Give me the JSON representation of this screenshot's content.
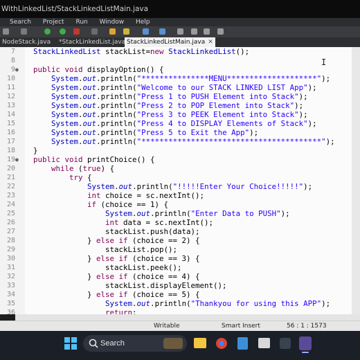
{
  "window": {
    "title": "WithLinkedList/StackLinkedListMain.java"
  },
  "menu": [
    "Search",
    "Project",
    "Run",
    "Window",
    "Help"
  ],
  "tabs": [
    {
      "label": "NodeStack.java",
      "active": false
    },
    {
      "label": "*StackLinkedList.java",
      "active": false
    },
    {
      "label": "StackLinkedListMain.java",
      "active": true
    }
  ],
  "editor": {
    "lines": [
      {
        "n": "7",
        "segs": [
          {
            "c": "ty",
            "t": "StackLinkedList"
          },
          {
            "c": "",
            "t": " stackList="
          },
          {
            "c": "kw",
            "t": "new"
          },
          {
            "c": "",
            "t": " "
          },
          {
            "c": "ty",
            "t": "StackLinkedList"
          },
          {
            "c": "",
            "t": "();"
          }
        ]
      },
      {
        "n": "8",
        "segs": []
      },
      {
        "n": "9",
        "fold": true,
        "segs": [
          {
            "c": "kw",
            "t": "public"
          },
          {
            "c": "",
            "t": " "
          },
          {
            "c": "kw",
            "t": "void"
          },
          {
            "c": "",
            "t": " displayOption() {"
          }
        ]
      },
      {
        "n": "10",
        "segs": [
          {
            "c": "",
            "t": "    "
          },
          {
            "c": "ty",
            "t": "System"
          },
          {
            "c": "",
            "t": "."
          },
          {
            "c": "fi",
            "t": "out"
          },
          {
            "c": "",
            "t": ".println("
          },
          {
            "c": "st",
            "t": "\"***************MENU********************\""
          },
          {
            "c": "",
            "t": ");"
          }
        ]
      },
      {
        "n": "11",
        "segs": [
          {
            "c": "",
            "t": "    "
          },
          {
            "c": "ty",
            "t": "System"
          },
          {
            "c": "",
            "t": "."
          },
          {
            "c": "fi",
            "t": "out"
          },
          {
            "c": "",
            "t": ".println("
          },
          {
            "c": "st",
            "t": "\"Welcome to our STACK LINKED LIST App\""
          },
          {
            "c": "",
            "t": ");"
          }
        ]
      },
      {
        "n": "12",
        "segs": [
          {
            "c": "",
            "t": "    "
          },
          {
            "c": "ty",
            "t": "System"
          },
          {
            "c": "",
            "t": "."
          },
          {
            "c": "fi",
            "t": "out"
          },
          {
            "c": "",
            "t": ".println("
          },
          {
            "c": "st",
            "t": "\"Press 1 to PUSH Element into Stack\""
          },
          {
            "c": "",
            "t": ");"
          }
        ]
      },
      {
        "n": "13",
        "segs": [
          {
            "c": "",
            "t": "    "
          },
          {
            "c": "ty",
            "t": "System"
          },
          {
            "c": "",
            "t": "."
          },
          {
            "c": "fi",
            "t": "out"
          },
          {
            "c": "",
            "t": ".println("
          },
          {
            "c": "st",
            "t": "\"Press 2 to POP Element into Stack\""
          },
          {
            "c": "",
            "t": ");"
          }
        ]
      },
      {
        "n": "14",
        "segs": [
          {
            "c": "",
            "t": "    "
          },
          {
            "c": "ty",
            "t": "System"
          },
          {
            "c": "",
            "t": "."
          },
          {
            "c": "fi",
            "t": "out"
          },
          {
            "c": "",
            "t": ".println("
          },
          {
            "c": "st",
            "t": "\"Press 3 to PEEK Element into Stack\""
          },
          {
            "c": "",
            "t": ");"
          }
        ]
      },
      {
        "n": "15",
        "segs": [
          {
            "c": "",
            "t": "    "
          },
          {
            "c": "ty",
            "t": "System"
          },
          {
            "c": "",
            "t": "."
          },
          {
            "c": "fi",
            "t": "out"
          },
          {
            "c": "",
            "t": ".println("
          },
          {
            "c": "st",
            "t": "\"Press 4 to DISPLAY Elements of Stack\""
          },
          {
            "c": "",
            "t": ");"
          }
        ]
      },
      {
        "n": "16",
        "segs": [
          {
            "c": "",
            "t": "    "
          },
          {
            "c": "ty",
            "t": "System"
          },
          {
            "c": "",
            "t": "."
          },
          {
            "c": "fi",
            "t": "out"
          },
          {
            "c": "",
            "t": ".println("
          },
          {
            "c": "st",
            "t": "\"Press 5 to Exit the App\""
          },
          {
            "c": "",
            "t": ");"
          }
        ]
      },
      {
        "n": "17",
        "segs": [
          {
            "c": "",
            "t": "    "
          },
          {
            "c": "ty",
            "t": "System"
          },
          {
            "c": "",
            "t": "."
          },
          {
            "c": "fi",
            "t": "out"
          },
          {
            "c": "",
            "t": ".println("
          },
          {
            "c": "st",
            "t": "\"****************************************\""
          },
          {
            "c": "",
            "t": ");"
          }
        ]
      },
      {
        "n": "18",
        "segs": [
          {
            "c": "",
            "t": "}"
          }
        ]
      },
      {
        "n": "19",
        "fold": true,
        "segs": [
          {
            "c": "kw",
            "t": "public"
          },
          {
            "c": "",
            "t": " "
          },
          {
            "c": "kw",
            "t": "void"
          },
          {
            "c": "",
            "t": " printChoice() {"
          }
        ]
      },
      {
        "n": "20",
        "segs": [
          {
            "c": "",
            "t": "    "
          },
          {
            "c": "kw",
            "t": "while"
          },
          {
            "c": "",
            "t": " ("
          },
          {
            "c": "kw",
            "t": "true"
          },
          {
            "c": "",
            "t": ") {"
          }
        ]
      },
      {
        "n": "21",
        "segs": [
          {
            "c": "",
            "t": "        "
          },
          {
            "c": "kw",
            "t": "try"
          },
          {
            "c": "",
            "t": " {"
          }
        ]
      },
      {
        "n": "22",
        "segs": [
          {
            "c": "",
            "t": "            "
          },
          {
            "c": "ty",
            "t": "System"
          },
          {
            "c": "",
            "t": "."
          },
          {
            "c": "fi",
            "t": "out"
          },
          {
            "c": "",
            "t": ".println("
          },
          {
            "c": "st",
            "t": "\"!!!!!Enter Your Choice!!!!!\""
          },
          {
            "c": "",
            "t": ");"
          }
        ]
      },
      {
        "n": "23",
        "segs": [
          {
            "c": "",
            "t": "            "
          },
          {
            "c": "kw",
            "t": "int"
          },
          {
            "c": "",
            "t": " choice = sc.nextInt();"
          }
        ]
      },
      {
        "n": "24",
        "segs": [
          {
            "c": "",
            "t": "            "
          },
          {
            "c": "kw",
            "t": "if"
          },
          {
            "c": "",
            "t": " (choice == 1) {"
          }
        ]
      },
      {
        "n": "25",
        "segs": [
          {
            "c": "",
            "t": "                "
          },
          {
            "c": "ty",
            "t": "System"
          },
          {
            "c": "",
            "t": "."
          },
          {
            "c": "fi",
            "t": "out"
          },
          {
            "c": "",
            "t": ".println("
          },
          {
            "c": "st",
            "t": "\"Enter Data to PUSH\""
          },
          {
            "c": "",
            "t": ");"
          }
        ]
      },
      {
        "n": "26",
        "segs": [
          {
            "c": "",
            "t": "                "
          },
          {
            "c": "kw",
            "t": "int"
          },
          {
            "c": "",
            "t": " data = sc.nextInt();"
          }
        ]
      },
      {
        "n": "27",
        "segs": [
          {
            "c": "",
            "t": "                stackList.push(data);"
          }
        ]
      },
      {
        "n": "28",
        "segs": [
          {
            "c": "",
            "t": "            } "
          },
          {
            "c": "kw",
            "t": "else if"
          },
          {
            "c": "",
            "t": " (choice == 2) {"
          }
        ]
      },
      {
        "n": "29",
        "segs": [
          {
            "c": "",
            "t": "                stackList.pop();"
          }
        ]
      },
      {
        "n": "30",
        "segs": [
          {
            "c": "",
            "t": "            } "
          },
          {
            "c": "kw",
            "t": "else if"
          },
          {
            "c": "",
            "t": " (choice == 3) {"
          }
        ]
      },
      {
        "n": "31",
        "segs": [
          {
            "c": "",
            "t": "                stackList.peek();"
          }
        ]
      },
      {
        "n": "32",
        "segs": [
          {
            "c": "",
            "t": "            } "
          },
          {
            "c": "kw",
            "t": "else if"
          },
          {
            "c": "",
            "t": " (choice == 4) {"
          }
        ]
      },
      {
        "n": "33",
        "segs": [
          {
            "c": "",
            "t": "                stackList.displayElement();"
          }
        ]
      },
      {
        "n": "34",
        "segs": [
          {
            "c": "",
            "t": "            } "
          },
          {
            "c": "kw",
            "t": "else if"
          },
          {
            "c": "",
            "t": " (choice == 5) {"
          }
        ]
      },
      {
        "n": "35",
        "segs": [
          {
            "c": "",
            "t": "                "
          },
          {
            "c": "ty",
            "t": "System"
          },
          {
            "c": "",
            "t": "."
          },
          {
            "c": "fi",
            "t": "out"
          },
          {
            "c": "",
            "t": ".println("
          },
          {
            "c": "st",
            "t": "\"Thankyou for using this APP\""
          },
          {
            "c": "",
            "t": ");"
          }
        ]
      },
      {
        "n": "36",
        "segs": [
          {
            "c": "",
            "t": "                "
          },
          {
            "c": "kw",
            "t": "return"
          },
          {
            "c": "",
            "t": ";"
          }
        ]
      }
    ]
  },
  "status": {
    "mode": "Writable",
    "insert": "Smart Insert",
    "position": "56 : 1 : 1573"
  },
  "taskbar": {
    "search_label": "Search"
  },
  "colors": {
    "keyword": "#7f0055",
    "type": "#0000c0",
    "string": "#2a00ff"
  }
}
